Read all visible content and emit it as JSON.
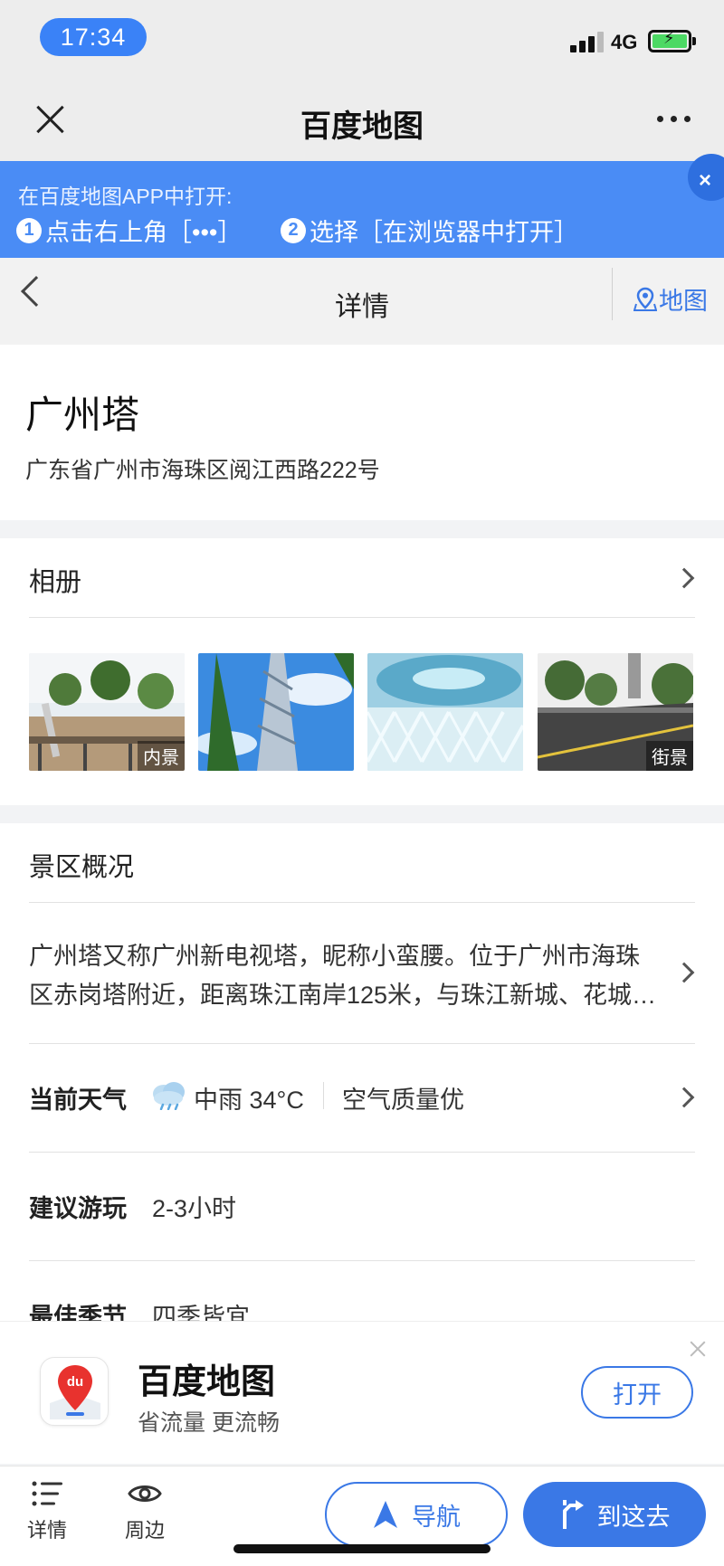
{
  "status_bar": {
    "time": "17:34",
    "network": "4G"
  },
  "nav": {
    "title": "百度地图"
  },
  "banner": {
    "line1": "在百度地图APP中打开:",
    "step1_num": "1",
    "step1_text": "点击右上角［•••］",
    "step2_num": "2",
    "step2_text": "选择［在浏览器中打开］",
    "close": "×"
  },
  "detail_header": {
    "title": "详情",
    "map_link": "地图"
  },
  "poi": {
    "name": "广州塔",
    "address": "广东省广州市海珠区阅江西路222号"
  },
  "album": {
    "title": "相册",
    "photos": [
      {
        "tag": "内景"
      },
      {
        "tag": ""
      },
      {
        "tag": ""
      },
      {
        "tag": "街景"
      }
    ]
  },
  "overview": {
    "title": "景区概况",
    "intro_line1": "广州塔又称广州新电视塔，昵称小蛮腰。位于广州市海珠",
    "intro_line2": "区赤岗塔附近，距离珠江南岸125米，与珠江新城、花城…",
    "weather_label": "当前天气",
    "weather_value": "中雨 34°C",
    "air_quality": "空气质量优",
    "suggest_label": "建议游玩",
    "suggest_value": "2-3小时",
    "season_label": "最佳季节",
    "season_value": "四季皆宜"
  },
  "promo": {
    "name": "百度地图",
    "subtitle": "省流量 更流畅",
    "open_label": "打开",
    "icon_text": "du"
  },
  "bottom_bar": {
    "tab_detail": "详情",
    "tab_nearby": "周边",
    "navigate": "导航",
    "go_here": "到这去"
  },
  "colors": {
    "accent": "#3a78e6",
    "banner": "#4a8cf5"
  }
}
